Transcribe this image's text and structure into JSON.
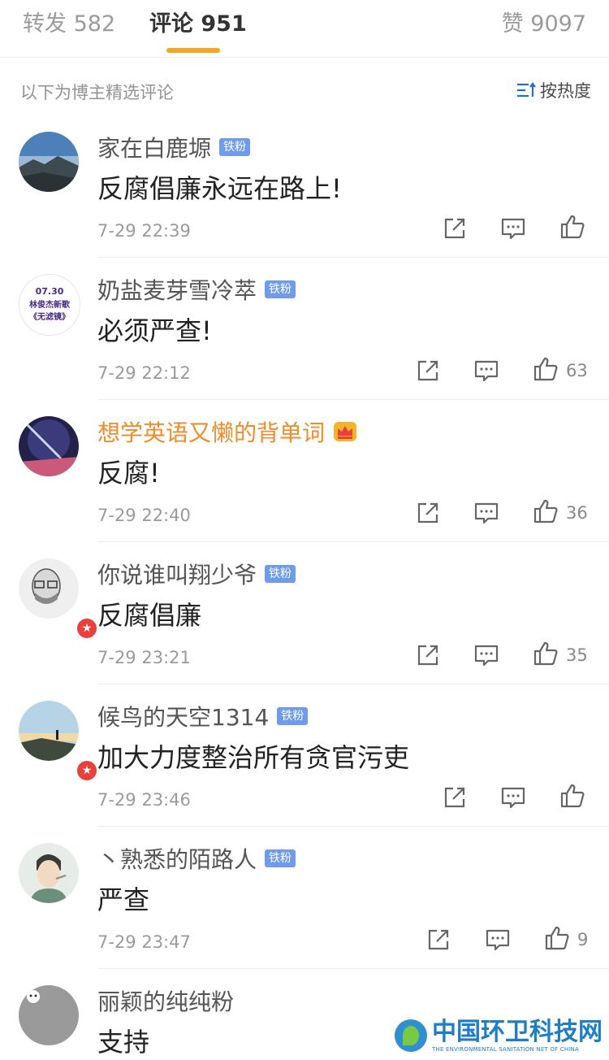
{
  "tabs": {
    "repost": "转发 582",
    "comments": "评论 951",
    "likes": "赞 9097"
  },
  "subheader": {
    "caption": "以下为博主精选评论",
    "sort_label": "按热度"
  },
  "colors": {
    "accent_underline": "#f5a623",
    "vip_name": "#f28b2a",
    "fan_badge": "#6f9ce8",
    "badge_red": "#e8413b"
  },
  "comments": [
    {
      "username": "家在白鹿塬",
      "badge": "铁粉",
      "text": "反腐倡廉永远在路上!",
      "time": "7-29 22:39",
      "likes": ""
    },
    {
      "username": "奶盐麦芽雪冷萃",
      "badge": "铁粉",
      "text": "必须严查!",
      "time": "7-29 22:12",
      "likes": "63",
      "avatar_text": [
        "07.30",
        "林俊杰新歌",
        "《无滤镜》"
      ]
    },
    {
      "username": "想学英语又懒的背单词",
      "badge": "",
      "text": "反腐!",
      "time": "7-29 22:40",
      "likes": "36",
      "badge_icon": "crown-icon"
    },
    {
      "username": "你说谁叫翔少爷",
      "badge": "铁粉",
      "text": "反腐倡廉",
      "time": "7-29 23:21",
      "likes": "35"
    },
    {
      "username": "候鸟的天空1314",
      "badge": "铁粉",
      "text": "加大力度整治所有贪官污吏",
      "time": "7-29 23:46",
      "likes": ""
    },
    {
      "username": "丶熟悉的陌路人",
      "badge": "铁粉",
      "text": "严查",
      "time": "7-29 23:47",
      "likes": "9"
    },
    {
      "username": "丽颖的纯纯粉",
      "badge": "",
      "text": "支持",
      "time": "",
      "likes": ""
    }
  ],
  "watermark": {
    "title": "中国环卫科技网",
    "subtitle": "THE ENVIRONMENTAL SANITATION NET OF CHINA"
  }
}
